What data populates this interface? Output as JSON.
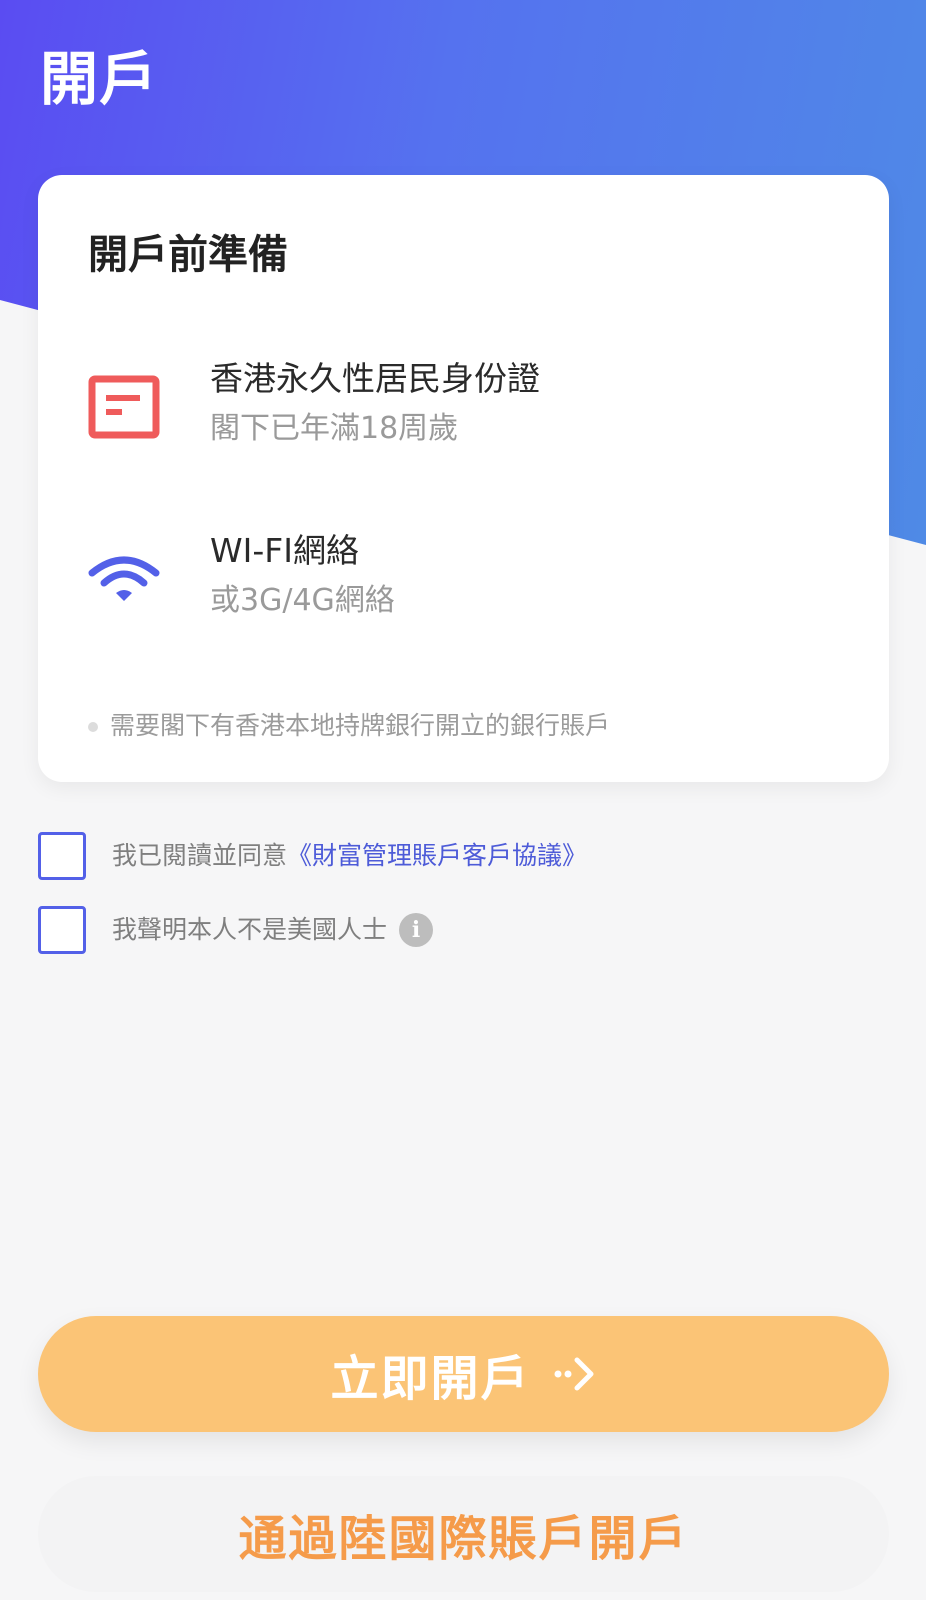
{
  "header": {
    "title": "開戶"
  },
  "card": {
    "title": "開戶前準備",
    "requirements": [
      {
        "icon": "id-card-icon",
        "main": "香港永久性居民身份證",
        "sub": "閣下已年滿18周歲"
      },
      {
        "icon": "wifi-icon",
        "main": "WI-FI網絡",
        "sub": "或3G/4G網絡"
      }
    ],
    "note": "需要閣下有香港本地持牌銀行開立的銀行賬戶"
  },
  "agreements": {
    "read_prefix": "我已閱讀並同意",
    "read_link": "《財富管理賬戶客戶協議》",
    "not_us_person": "我聲明本人不是美國人士",
    "info_icon": "i"
  },
  "buttons": {
    "primary": "立即開戶",
    "secondary": "通過陸國際賬戶開戶"
  },
  "colors": {
    "header_gradient_start": "#5a4cf2",
    "header_gradient_end": "#4f8ae6",
    "accent_blue": "#5360e8",
    "id_card_red": "#ef5b5b",
    "primary_button": "#fbc476",
    "secondary_text": "#f59b4a"
  }
}
